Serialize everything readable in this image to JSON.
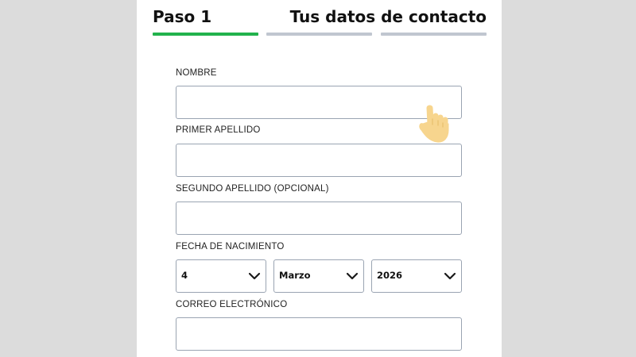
{
  "step": {
    "number_label": "Paso 1",
    "title": "Tus datos de contacto",
    "progress": {
      "total_segments": 3,
      "active_segments": 1,
      "active_color": "#22b24c",
      "inactive_color": "#c0c6d0"
    }
  },
  "form": {
    "nombre": {
      "label": "NOMBRE",
      "value": ""
    },
    "primer_apellido": {
      "label": "PRIMER APELLIDO",
      "value": ""
    },
    "segundo_apellido": {
      "label": "SEGUNDO APELLIDO (OPCIONAL)",
      "value": ""
    },
    "fecha_nacimiento": {
      "label": "FECHA DE NACIMIENTO",
      "day": "4",
      "month": "Marzo",
      "year": "2026"
    },
    "correo": {
      "label": "CORREO ELECTRÓNICO",
      "value": ""
    }
  },
  "icons": {
    "pointer": "hand-pointer-icon",
    "dropdown": "chevron-down-icon"
  },
  "colors": {
    "background": "#dcdcdc",
    "panel": "#ffffff",
    "field_border": "#9aa4b2",
    "hand_fill": "#f7d58e"
  }
}
